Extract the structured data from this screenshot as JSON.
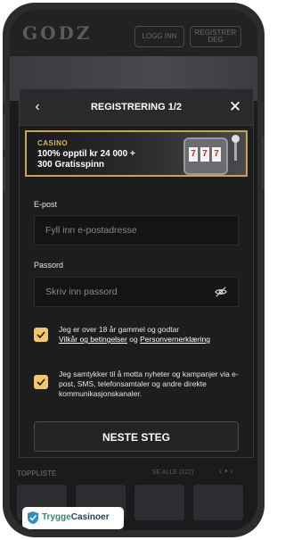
{
  "site": {
    "logo": "GODZ",
    "login_label": "LOGG INN",
    "register_label_line1": "REGISTRER",
    "register_label_line2": "DEG"
  },
  "modal": {
    "title": "REGISTRERING 1/2",
    "banner": {
      "tag": "CASINO",
      "line1": "100% opptil kr 24 000 +",
      "line2": "300 Gratisspinn",
      "slot_reels": [
        "7",
        "7",
        "7"
      ]
    },
    "email": {
      "label": "E-post",
      "placeholder": "Fyll inn e-postadresse"
    },
    "password": {
      "label": "Passord",
      "placeholder": "Skriv inn passord"
    },
    "consent_terms": {
      "checked": true,
      "text_before": "Jeg er over 18 år gammel og godtar",
      "terms_link": "Vilkår og betingelser",
      "joiner": "og",
      "privacy_link": "Personvernerklæring"
    },
    "consent_marketing": {
      "checked": true,
      "text": "Jeg samtykker til å motta nyheter og kampanjer via e-post, SMS, telefonsamtaler og andre direkte kommunikasjonskanaler."
    },
    "next_label": "NESTE STEG"
  },
  "below": {
    "toplist_label": "TOPPLISTE",
    "see_all_label": "SE ALLE (222)"
  },
  "watermark": {
    "part1": "Trygge",
    "part2": "Casinoer"
  },
  "colors": {
    "accent_gold": "#f2c66b",
    "banner_border": "#c9a44a"
  }
}
